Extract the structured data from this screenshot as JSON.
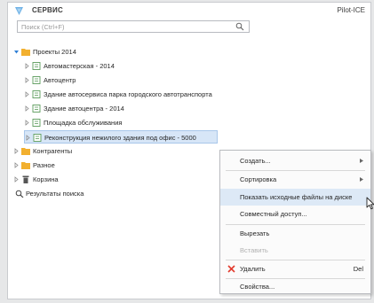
{
  "header": {
    "title": "СЕРВИС",
    "app_name": "Pilot-ICE"
  },
  "search": {
    "placeholder": "Поиск (Ctrl+F)"
  },
  "tree": {
    "items": [
      {
        "label": "Проекты 2014"
      },
      {
        "label": "Автомастерская - 2014"
      },
      {
        "label": "Автоцентр"
      },
      {
        "label": "Здание автосервиса парка городского автотранспорта"
      },
      {
        "label": "Здание автоцентра - 2014"
      },
      {
        "label": "Площадка обслуживания"
      },
      {
        "label": "Реконструкция нежилого здания под офис - 5000"
      },
      {
        "label": "Контрагенты"
      },
      {
        "label": "Разное"
      },
      {
        "label": "Корзина"
      },
      {
        "label": "Результаты поиска"
      }
    ]
  },
  "context_menu": {
    "items": [
      {
        "label": "Создать...",
        "submenu": true
      },
      {
        "label": "Сортировка",
        "submenu": true
      },
      {
        "label": "Показать исходные файлы на диске",
        "highlighted": true
      },
      {
        "label": "Совместный доступ..."
      },
      {
        "label": "Вырезать"
      },
      {
        "label": "Вставить",
        "disabled": true
      },
      {
        "label": "Удалить",
        "shortcut": "Del",
        "icon": "delete-x-icon"
      },
      {
        "label": "Свойства..."
      }
    ]
  },
  "colors": {
    "folder": "#f2b02f",
    "delete": "#e23b2e",
    "selection": "#d7e6f7",
    "highlight": "#dde9f6",
    "logo": "#6fb2e6"
  }
}
